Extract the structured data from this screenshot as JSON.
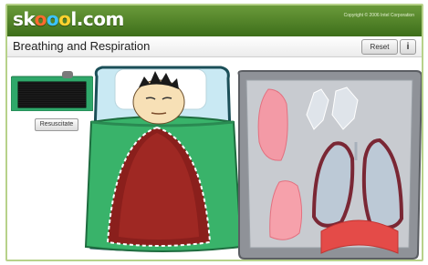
{
  "brand": {
    "logo_text": "sk⬤⬤l.com",
    "copyright": "Copyright © 2006 Intel Corporation"
  },
  "app": {
    "title": "Breathing and Respiration"
  },
  "toolbar": {
    "reset_label": "Reset",
    "info_label": "i"
  },
  "controls": {
    "resuscitate_label": "Resuscitate"
  },
  "colors": {
    "header_green": "#4d8025",
    "blanket_green": "#39b36a",
    "lung_red": "#c4394a",
    "tray_gray": "#b9bcc2"
  }
}
